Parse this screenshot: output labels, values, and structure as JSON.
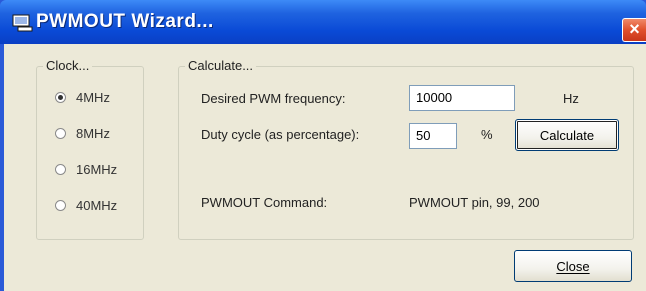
{
  "window": {
    "title": "PWMOUT Wizard...",
    "close_glyph": "×",
    "title_icon": "window-app-icon"
  },
  "clock": {
    "legend": "Clock...",
    "options": [
      {
        "label": "4MHz",
        "checked": true
      },
      {
        "label": "8MHz",
        "checked": false
      },
      {
        "label": "16MHz",
        "checked": false
      },
      {
        "label": "40MHz",
        "checked": false
      }
    ]
  },
  "calculate": {
    "legend": "Calculate...",
    "frequency_label": "Desired PWM frequency:",
    "frequency_value": "10000",
    "frequency_unit": "Hz",
    "duty_label": "Duty cycle (as percentage):",
    "duty_value": "50",
    "duty_unit": "%",
    "calculate_button": "Calculate",
    "command_label": "PWMOUT Command:",
    "command_value": "PWMOUT pin, 99, 200"
  },
  "footer": {
    "close_button": "Close"
  },
  "colors": {
    "titlebar": "#0a4ad6",
    "dialog_face": "#ece9d8",
    "close_button_red": "#e0502c"
  }
}
